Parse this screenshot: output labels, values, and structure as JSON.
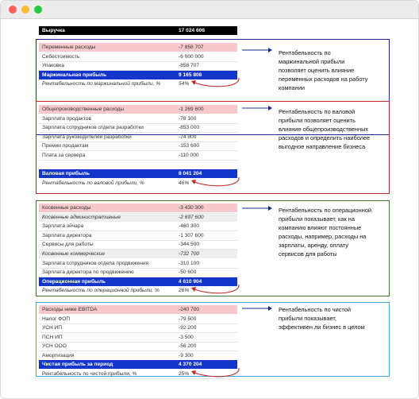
{
  "header": {
    "label": "Выручка",
    "value": "17 024 606"
  },
  "sections": [
    {
      "frame_color": "#1a2a8c",
      "note": [
        "Рентабельность по",
        "маржинальной прибыли",
        "позволяет оценить влияние",
        "переменных расходов на работу",
        "компании"
      ],
      "rows": [
        {
          "label": "Переменные расходы",
          "value": "-7 858 707",
          "style": "pink"
        },
        {
          "label": "Себестоимость",
          "value": "-6 000 000",
          "style": ""
        },
        {
          "label": "Упаковка",
          "value": "-858 707",
          "style": ""
        },
        {
          "label": "Маржинальная прибыль",
          "value": "9 165 808",
          "style": "blue"
        },
        {
          "label": "Рентабельность по маржинальной прибыли, %",
          "value": "54%",
          "style": "italic"
        }
      ]
    },
    {
      "frame_color": "#c0282a",
      "note": [
        "Рентабельность по валовой",
        "прибыли позволяет оценить",
        "влияние общепроизводственных",
        "расходов и определить наиболее",
        "выгодное направление бизнеса"
      ],
      "rows": [
        {
          "label": "Общепроизводственные расходы",
          "value": "-1 269 600",
          "style": "pink"
        },
        {
          "label": "Зарплата продактов",
          "value": "-78 100",
          "style": ""
        },
        {
          "label": "Зарплата сотрудников отдела разработки",
          "value": "-853 000",
          "style": ""
        },
        {
          "label": "Зарплата руководителей разработки",
          "value": "-74 900",
          "style": ""
        },
        {
          "label": "Премии продактам",
          "value": "-153 600",
          "style": ""
        },
        {
          "label": "Плата за сервера",
          "value": "-110 000",
          "style": ""
        },
        {
          "label": "",
          "value": "",
          "style": ""
        },
        {
          "label": "Валовая прибыль",
          "value": "8 041 204",
          "style": "blue"
        },
        {
          "label": "Рентабельность по валовой прибыли, %",
          "value": "46%",
          "style": "italic"
        }
      ]
    },
    {
      "frame_color": "#3a7a2c",
      "note": [
        "Рентабельность по операционной",
        "прибыли показывает, как на",
        "компанию влияют постоянные",
        "расходы, например, расходы на",
        "зарплаты, аренду, оплату",
        "сервисов для работы"
      ],
      "rows": [
        {
          "label": "Косвенные расходы",
          "value": "-3 430 300",
          "style": "pink"
        },
        {
          "label": "Косвенные административные",
          "value": "-2 697 600",
          "style": "grey italic"
        },
        {
          "label": "Зарплата эйчара",
          "value": "-460 300",
          "style": ""
        },
        {
          "label": "Зарплата директора",
          "value": "-1 307 600",
          "style": ""
        },
        {
          "label": "Сервисы для работы",
          "value": "-344 500",
          "style": ""
        },
        {
          "label": "Косвенные коммерческие",
          "value": "-732 700",
          "style": "grey italic"
        },
        {
          "label": "Зарплата сотрудников отдела продвижения",
          "value": "-310 100",
          "style": ""
        },
        {
          "label": "Зарплата директора по продвижению",
          "value": "-50 600",
          "style": ""
        },
        {
          "label": "Операционная прибыль",
          "value": "4 610 904",
          "style": "blue"
        },
        {
          "label": "Рентабельность по операционной прибыли, %",
          "value": "26%",
          "style": "italic"
        }
      ]
    },
    {
      "frame_color": "#4aa4d8",
      "note": [
        "Рентабельность по чистой",
        "прибыли показывает,",
        "эффективен ли бизнес в целом"
      ],
      "rows": [
        {
          "label": "Расходы ниже EBITDA",
          "value": "-240 700",
          "style": "pink"
        },
        {
          "label": "Налог ФОП",
          "value": "-79 500",
          "style": ""
        },
        {
          "label": "УСН ИП",
          "value": "-92 200",
          "style": ""
        },
        {
          "label": "ПСН ИП",
          "value": "-3 500",
          "style": ""
        },
        {
          "label": "УСН ООО",
          "value": "-56 200",
          "style": ""
        },
        {
          "label": "Амортизация",
          "value": "-9 300",
          "style": ""
        },
        {
          "label": "Чистая прибыль за период",
          "value": "4 370 204",
          "style": "blue"
        },
        {
          "label": "Рентабельность по чистой прибыли, %",
          "value": "25%",
          "style": ""
        }
      ]
    }
  ]
}
